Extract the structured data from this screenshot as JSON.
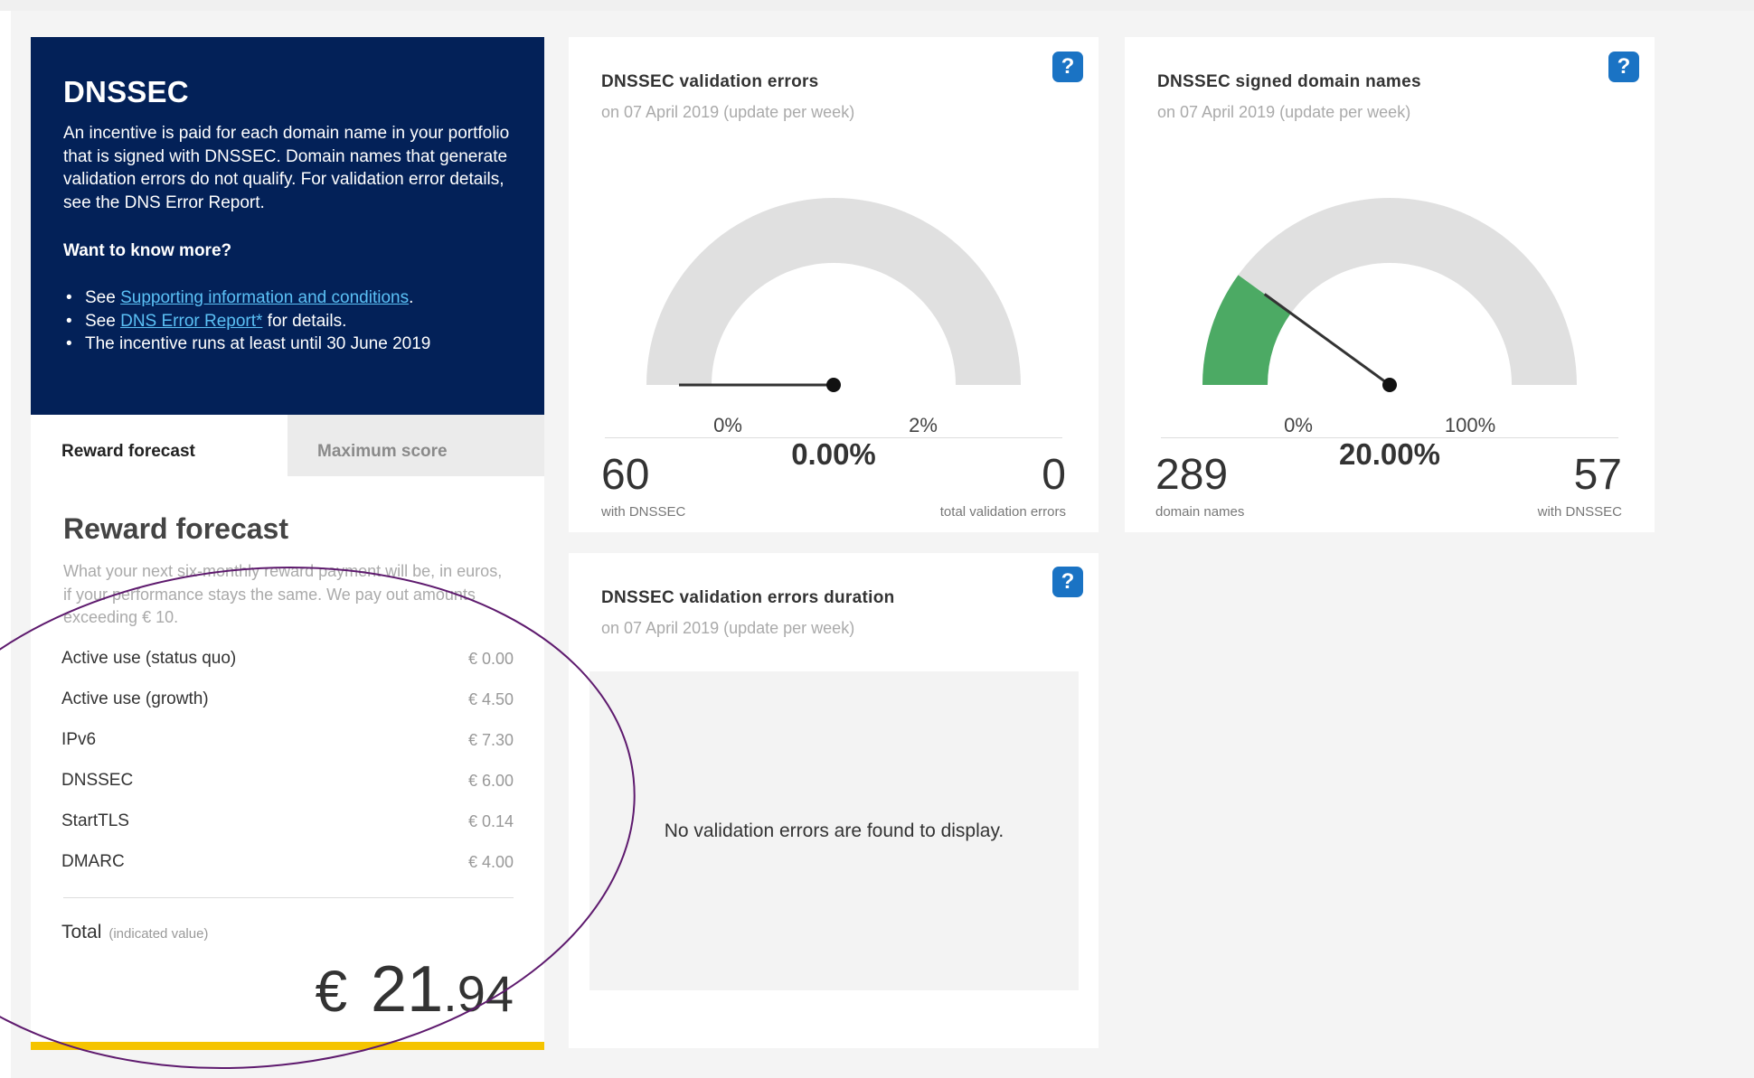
{
  "intro": {
    "title": "DNSSEC",
    "description": "An incentive is paid for each domain name in your portfolio that is signed with DNSSEC. Domain names that generate validation errors do not qualify. For validation error details, see the DNS Error Report.",
    "more_heading": "Want to know more?",
    "bullets": [
      {
        "prefix": "See ",
        "link": "Supporting information and conditions",
        "suffix": "."
      },
      {
        "prefix": "See ",
        "link": "DNS Error Report*",
        "suffix": " for details."
      },
      {
        "text": "The incentive runs at least until 30 June 2019"
      }
    ]
  },
  "tabs": [
    {
      "label": "Reward forecast",
      "active": true
    },
    {
      "label": "Maximum score",
      "active": false
    }
  ],
  "reward": {
    "heading": "Reward forecast",
    "description": "What your next six-monthly reward payment will be, in euros, if your performance stays the same. We pay out amounts exceeding € 10.",
    "rows": [
      {
        "label": "Active use (status quo)",
        "value": "€ 0.00"
      },
      {
        "label": "Active use (growth)",
        "value": "€ 4.50"
      },
      {
        "label": "IPv6",
        "value": "€ 7.30"
      },
      {
        "label": "DNSSEC",
        "value": "€ 6.00"
      },
      {
        "label": "StartTLS",
        "value": "€ 0.14"
      },
      {
        "label": "DMARC",
        "value": "€ 4.00"
      }
    ],
    "total_label": "Total",
    "total_note": "(indicated value)",
    "total_currency": "€",
    "total_int": "21",
    "total_dec": ".94"
  },
  "cards": {
    "validation_errors": {
      "title": "DNSSEC validation errors",
      "subtitle": "on 07 April 2019 (update per week)",
      "gauge_value": 0,
      "gauge_min_label": "0%",
      "gauge_max_label": "2%",
      "gauge_readout": "0.00%",
      "left_number": "60",
      "left_label": "with DNSSEC",
      "right_number": "0",
      "right_label": "total validation errors"
    },
    "signed_domains": {
      "title": "DNSSEC signed domain names",
      "subtitle": "on 07 April 2019 (update per week)",
      "gauge_value": 0.2,
      "gauge_min_label": "0%",
      "gauge_max_label": "100%",
      "gauge_readout": "20.00%",
      "left_number": "289",
      "left_label": "domain names",
      "right_number": "57",
      "right_label": "with DNSSEC"
    },
    "errors_duration": {
      "title": "DNSSEC validation errors duration",
      "subtitle": "on 07 April 2019 (update per week)",
      "empty_message": "No validation errors are found to display."
    }
  },
  "help_label": "?",
  "colors": {
    "intro_bg": "#032158",
    "link": "#5bc0f5",
    "help_bg": "#1a73c4",
    "gauge_track": "#e0e0e0",
    "gauge_fill": "#4caa64",
    "accent_bar": "#f5c400",
    "annotation": "#5e1a6e"
  }
}
